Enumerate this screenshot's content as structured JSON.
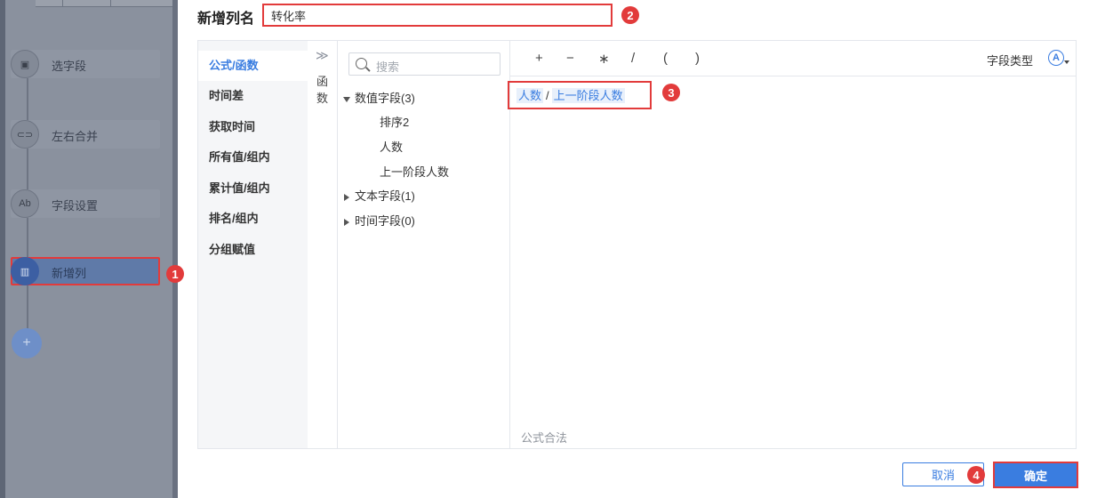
{
  "left_flow": {
    "steps": [
      {
        "label": "选字段",
        "icon": "select-field-icon"
      },
      {
        "label": "左右合并",
        "icon": "merge-icon"
      },
      {
        "label": "字段设置",
        "icon": "field-settings-icon"
      },
      {
        "label": "新增列",
        "icon": "new-column-icon"
      }
    ],
    "add_symbol": "+"
  },
  "header": {
    "title": "新增列名",
    "name_value": "转化率"
  },
  "categories": [
    {
      "label": "公式/函数",
      "active": true
    },
    {
      "label": "时间差"
    },
    {
      "label": "获取时间"
    },
    {
      "label": "所有值/组内"
    },
    {
      "label": "累计值/组内"
    },
    {
      "label": "排名/组内"
    },
    {
      "label": "分组赋值"
    }
  ],
  "function_panel": {
    "expand_symbol": "≫",
    "label": "函数"
  },
  "fields": {
    "search_placeholder": "搜索",
    "groups": [
      {
        "label": "数值字段(3)",
        "expanded": true,
        "items": [
          "排序2",
          "人数",
          "上一阶段人数"
        ]
      },
      {
        "label": "文本字段(1)",
        "expanded": false
      },
      {
        "label": "时间字段(0)",
        "expanded": false
      }
    ]
  },
  "editor": {
    "operators": [
      "+",
      "−",
      "∗",
      "/",
      "(",
      ")"
    ],
    "field_type_label": "字段类型",
    "field_type_icon": "A",
    "formula": {
      "left": "人数",
      "op": "/",
      "right": "上一阶段人数"
    },
    "validation": "公式合法"
  },
  "footer": {
    "cancel": "取消",
    "ok": "确定"
  },
  "badges": [
    "1",
    "2",
    "3",
    "4"
  ],
  "colors": {
    "accent": "#3a7de0",
    "highlight": "#e23b3b"
  }
}
